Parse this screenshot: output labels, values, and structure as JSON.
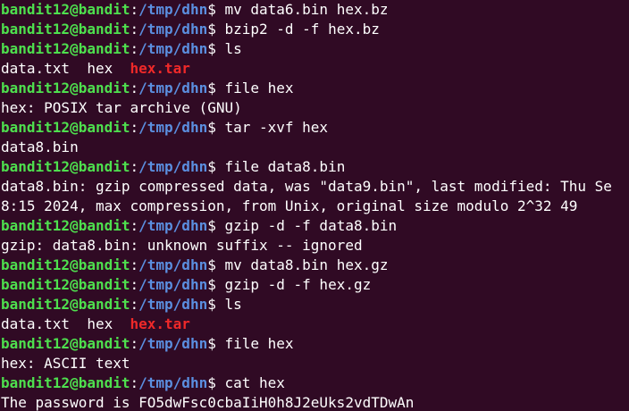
{
  "prompt": {
    "user": "bandit12@bandit",
    "colon": ":",
    "path": "/tmp/dhn",
    "symbol": "$ "
  },
  "colors": {
    "background": "#300a24",
    "prompt_user": "#4ee04e",
    "prompt_path": "#5b8fe0",
    "archive_file": "#ef2929",
    "text": "#ffffff"
  },
  "lines": [
    {
      "kind": "prompt",
      "cmd": "mv data6.bin hex.bz"
    },
    {
      "kind": "prompt",
      "cmd": "bzip2 -d -f hex.bz"
    },
    {
      "kind": "prompt",
      "cmd": "ls"
    },
    {
      "kind": "ls",
      "plain": "data.txt  hex  ",
      "archive": "hex.tar"
    },
    {
      "kind": "prompt",
      "cmd": "file hex"
    },
    {
      "kind": "output",
      "text": "hex: POSIX tar archive (GNU)"
    },
    {
      "kind": "prompt",
      "cmd": "tar -xvf hex"
    },
    {
      "kind": "output",
      "text": "data8.bin"
    },
    {
      "kind": "prompt",
      "cmd": "file data8.bin"
    },
    {
      "kind": "output",
      "text": "data8.bin: gzip compressed data, was \"data9.bin\", last modified: Thu Se"
    },
    {
      "kind": "output",
      "text": "8:15 2024, max compression, from Unix, original size modulo 2^32 49"
    },
    {
      "kind": "prompt",
      "cmd": "gzip -d -f data8.bin"
    },
    {
      "kind": "output",
      "text": "gzip: data8.bin: unknown suffix -- ignored"
    },
    {
      "kind": "prompt",
      "cmd": "mv data8.bin hex.gz"
    },
    {
      "kind": "prompt",
      "cmd": "gzip -d -f hex.gz"
    },
    {
      "kind": "prompt",
      "cmd": "ls"
    },
    {
      "kind": "ls",
      "plain": "data.txt  hex  ",
      "archive": "hex.tar"
    },
    {
      "kind": "prompt",
      "cmd": "file hex"
    },
    {
      "kind": "output",
      "text": "hex: ASCII text"
    },
    {
      "kind": "prompt",
      "cmd": "cat hex"
    },
    {
      "kind": "output",
      "text": "The password is FO5dwFsc0cbaIiH0h8J2eUks2vdTDwAn"
    }
  ]
}
